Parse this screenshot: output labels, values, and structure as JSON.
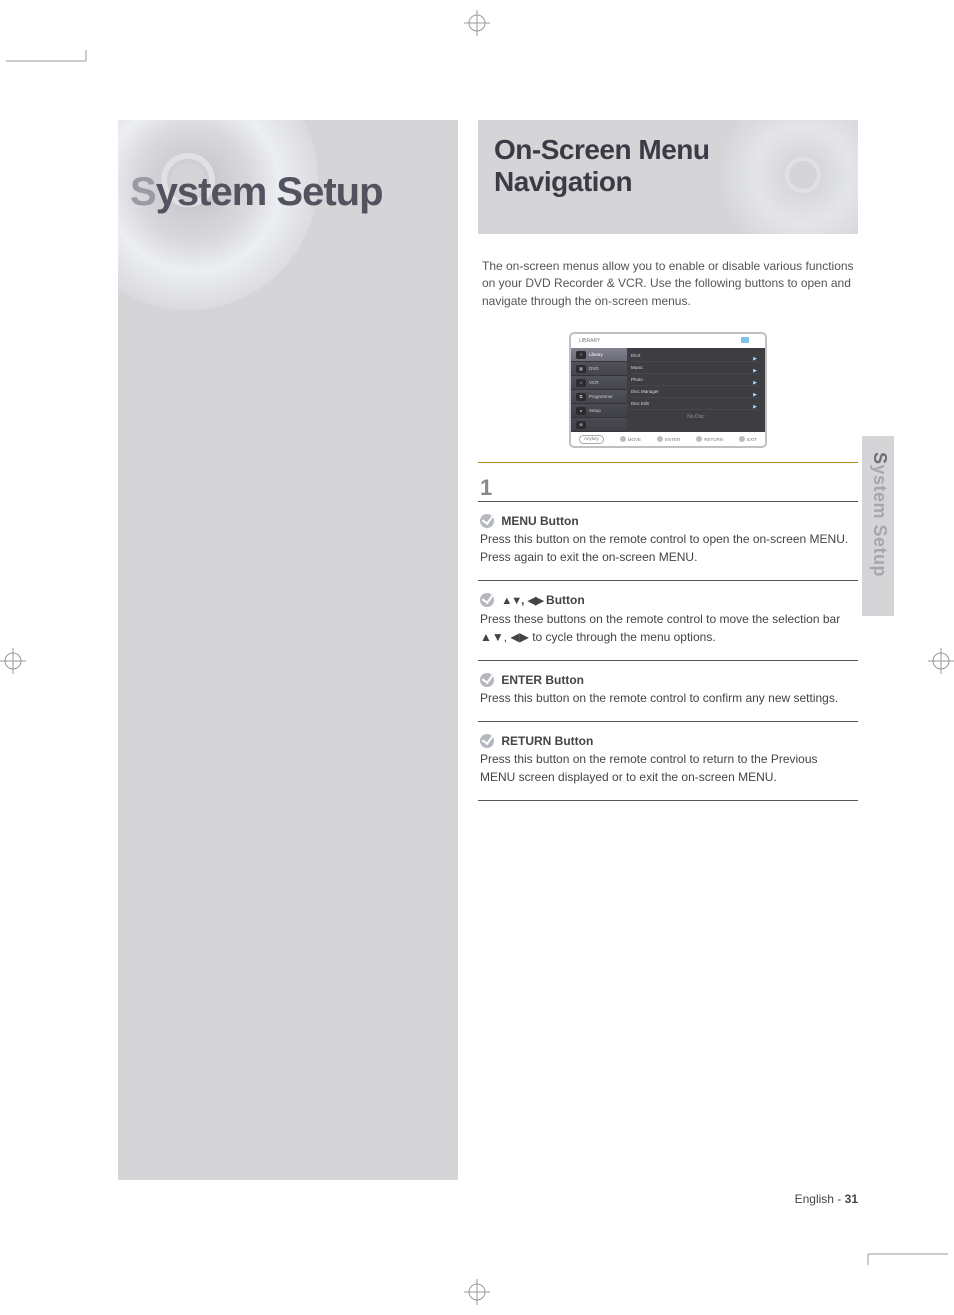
{
  "page": {
    "english_label": "English",
    "number": "31"
  },
  "left": {
    "title_first": "S",
    "title_rest": "ystem Setup"
  },
  "side_tab": {
    "first": "S",
    "rest": "ystem Setup"
  },
  "right": {
    "header": "On-Screen Menu Navigation",
    "intro": "The on-screen menus allow you to enable or disable various functions on your DVD Recorder & VCR. Use the following buttons to open and navigate through the on-screen menus."
  },
  "menu": {
    "titlebar": "LIBRARY",
    "sidebar": [
      {
        "icon": "≡",
        "label": "Library",
        "selected": true
      },
      {
        "icon": "▦",
        "label": "DVD"
      },
      {
        "icon": "♫",
        "label": "VCR"
      },
      {
        "icon": "⧉",
        "label": "Programme"
      },
      {
        "icon": "●",
        "label": "Setup"
      },
      {
        "icon": "✿",
        "label": ""
      }
    ],
    "main_items": [
      "DivX",
      "Music",
      "Photo",
      "Disc Manager",
      "Disc Edit"
    ],
    "nodisc": "No Disc",
    "footer": {
      "anykey": "Anykey",
      "move": "MOVE",
      "enter": "ENTER",
      "return": "RETURN",
      "exit": "EXIT"
    }
  },
  "steps": [
    {
      "title": "MENU Button",
      "body": "Press this button on the remote control to open the on-screen MENU. Press again to exit the on-screen MENU."
    },
    {
      "title": "▲▼, ◀▶ Button",
      "body": "Press these buttons on the remote control to move the selection bar ▲▼, ◀▶ to cycle through the menu options."
    },
    {
      "title": "ENTER Button",
      "body": "Press this button on the remote control to confirm any new settings."
    },
    {
      "title": "RETURN Button",
      "body": "Press this button on the remote control to return to the Previous MENU screen displayed or to exit the on-screen MENU."
    }
  ],
  "nav_step_label": "1"
}
